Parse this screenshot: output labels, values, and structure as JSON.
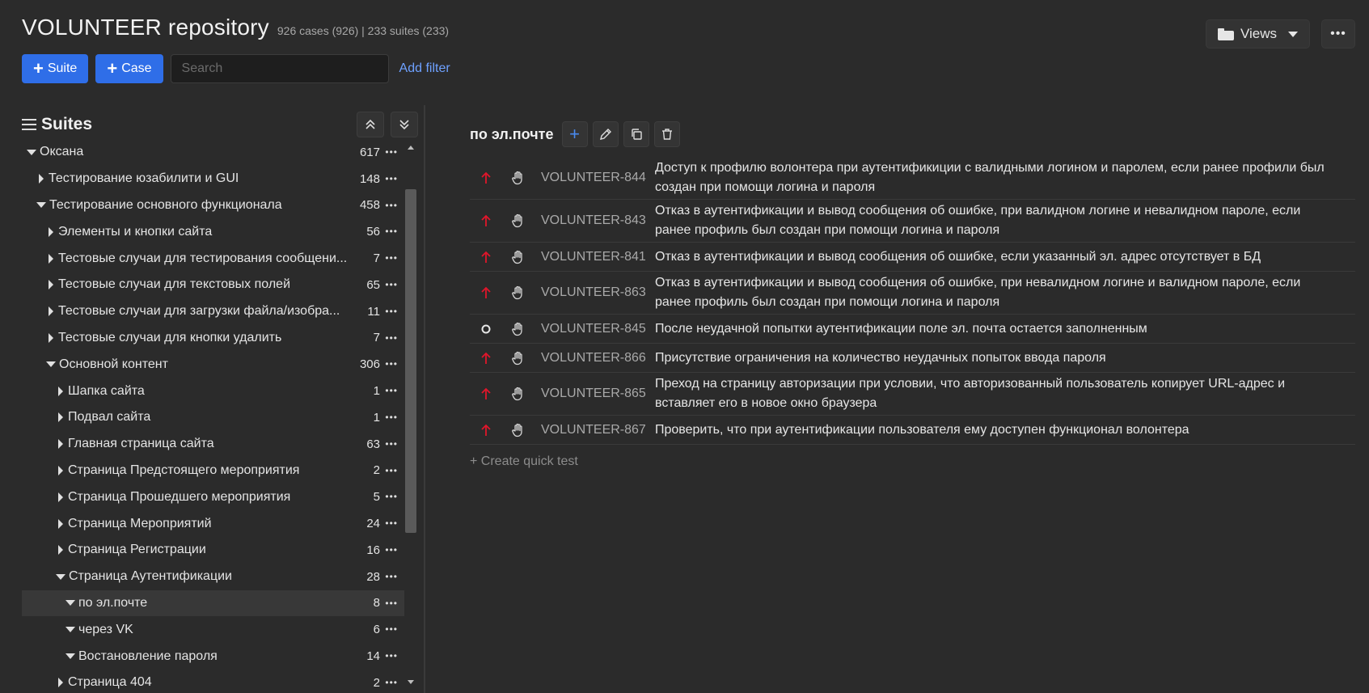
{
  "header": {
    "title": "VOLUNTEER repository",
    "stats": "926 cases (926) | 233 suites (233)"
  },
  "top_right": {
    "views_label": "Views",
    "more_label": "•••"
  },
  "toolbar": {
    "suite_label": "Suite",
    "case_label": "Case",
    "search_placeholder": "Search",
    "add_filter_label": "Add filter"
  },
  "sidebar": {
    "title": "Suites",
    "more_label": "•••",
    "tree": [
      {
        "label": "Оксана",
        "count": "617",
        "depth": 0,
        "state": "open"
      },
      {
        "label": "Тестирование юзабилити и GUI",
        "count": "148",
        "depth": 1,
        "state": "closed"
      },
      {
        "label": "Тестирование основного функционала",
        "count": "458",
        "depth": 1,
        "state": "open"
      },
      {
        "label": "Элементы и кнопки сайта",
        "count": "56",
        "depth": 2,
        "state": "closed"
      },
      {
        "label": "Тестовые случаи для тестирования сообщени...",
        "count": "7",
        "depth": 2,
        "state": "closed"
      },
      {
        "label": "Тестовые случаи для текстовых полей",
        "count": "65",
        "depth": 2,
        "state": "closed"
      },
      {
        "label": "Тестовые случаи для загрузки файла/изобра...",
        "count": "11",
        "depth": 2,
        "state": "closed"
      },
      {
        "label": "Тестовые случаи для кнопки удалить",
        "count": "7",
        "depth": 2,
        "state": "closed"
      },
      {
        "label": "Основной контент",
        "count": "306",
        "depth": 2,
        "state": "open"
      },
      {
        "label": "Шапка сайта",
        "count": "1",
        "depth": 3,
        "state": "closed"
      },
      {
        "label": "Подвал сайта",
        "count": "1",
        "depth": 3,
        "state": "closed"
      },
      {
        "label": "Главная страница сайта",
        "count": "63",
        "depth": 3,
        "state": "closed"
      },
      {
        "label": "Страница Предстоящего мероприятия",
        "count": "2",
        "depth": 3,
        "state": "closed"
      },
      {
        "label": "Страница Прошедшего мероприятия",
        "count": "5",
        "depth": 3,
        "state": "closed"
      },
      {
        "label": "Страница Мероприятий",
        "count": "24",
        "depth": 3,
        "state": "closed"
      },
      {
        "label": "Страница Регистрации",
        "count": "16",
        "depth": 3,
        "state": "closed"
      },
      {
        "label": "Страница Аутентификации",
        "count": "28",
        "depth": 3,
        "state": "open"
      },
      {
        "label": "по эл.почте",
        "count": "8",
        "depth": 4,
        "state": "open",
        "selected": true
      },
      {
        "label": "через VK",
        "count": "6",
        "depth": 4,
        "state": "open"
      },
      {
        "label": "Востановление пароля",
        "count": "14",
        "depth": 4,
        "state": "open"
      },
      {
        "label": "Страница 404",
        "count": "2",
        "depth": 3,
        "state": "closed"
      }
    ]
  },
  "main": {
    "suite_title": "по эл.почте",
    "cases": [
      {
        "priority": "high",
        "id": "VOLUNTEER-844",
        "text": "Доступ к профилю волонтера при аутентификиции с валидными логином и паролем, если ранее профили был создан при помощи логина и пароля"
      },
      {
        "priority": "high",
        "id": "VOLUNTEER-843",
        "text": "Отказ в аутентификации и вывод сообщения об ошибке, при валидном логине и невалидном пароле, если ранее профиль был создан при помощи логина и пароля"
      },
      {
        "priority": "high",
        "id": "VOLUNTEER-841",
        "text": "Отказ в аутентификации и вывод сообщения об ошибке, если указанный эл. адрес отсутствует в БД"
      },
      {
        "priority": "high",
        "id": "VOLUNTEER-863",
        "text": "Отказ в аутентификации и вывод сообщения об ошибке, при невалидном логине и валидном пароле, если ранее профиль был создан при помощи логина и пароля"
      },
      {
        "priority": "none",
        "id": "VOLUNTEER-845",
        "text": "После неудачной попытки аутентификации поле эл. почта остается заполненным"
      },
      {
        "priority": "high",
        "id": "VOLUNTEER-866",
        "text": "Присутствие ограничения на количество неудачных попыток ввода пароля"
      },
      {
        "priority": "high",
        "id": "VOLUNTEER-865",
        "text": "Преход на страницу авторизации при условии, что авторизованный пользователь копирует URL-адрес и вставляет его в новое окно браузера"
      },
      {
        "priority": "high",
        "id": "VOLUNTEER-867",
        "text": "Проверить, что при аутентификации пользователя ему доступен функционал волонтера"
      }
    ],
    "quick_test_label": "+ Create quick test"
  },
  "colors": {
    "accent": "#2f6ee8",
    "link": "#6ea1ff",
    "priority_high": "#e0162b",
    "background": "#2b2b2b"
  }
}
